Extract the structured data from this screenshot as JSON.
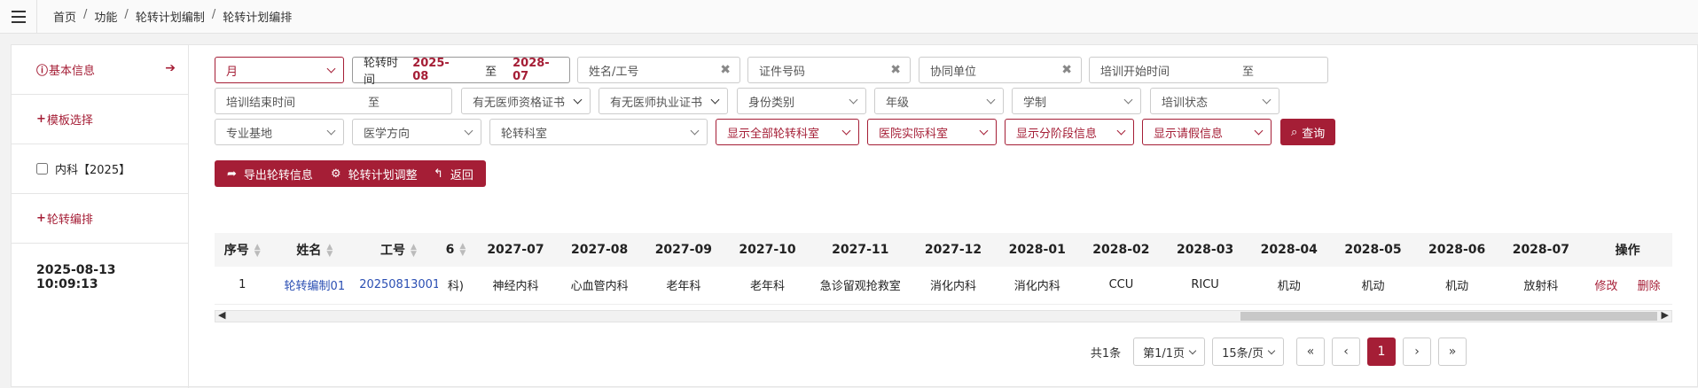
{
  "breadcrumb": [
    "首页",
    "功能",
    "轮转计划编制",
    "轮转计划编排"
  ],
  "sidebar": {
    "basic_info": "基本信息",
    "template_select": "模板选择",
    "checkbox_label": "内科【2025】",
    "rotation_edit": "轮转编排",
    "timestamp": "2025-08-13 10:09:13"
  },
  "filters": {
    "period": "月",
    "rotation_time_label": "轮转时间",
    "rotation_start": "2025-08",
    "rotation_to": "至",
    "rotation_end": "2028-07",
    "name_placeholder": "姓名/工号",
    "cert_placeholder": "证件号码",
    "coop_placeholder": "协同单位",
    "train_start_placeholder": "培训开始时间",
    "train_start_to": "至",
    "train_end_placeholder": "培训结束时间",
    "train_end_to": "至",
    "doctor_qual": "有无医师资格证书",
    "doctor_practice": "有无医师执业证书",
    "identity": "身份类别",
    "grade": "年级",
    "edu_system": "学制",
    "train_status": "培训状态",
    "base": "专业基地",
    "direction": "医学方向",
    "rotation_dept": "轮转科室",
    "show_all_dept": "显示全部轮转科室",
    "hospital_dept": "医院实际科室",
    "show_stage": "显示分阶段信息",
    "show_leave": "显示请假信息",
    "query_button": "查询"
  },
  "actions": {
    "export": "导出轮转信息",
    "adjust": "轮转计划调整",
    "back": "返回"
  },
  "table": {
    "headers": [
      "序号",
      "姓名",
      "工号",
      "6",
      "2027-07",
      "2027-08",
      "2027-09",
      "2027-10",
      "2027-11",
      "2027-12",
      "2028-01",
      "2028-02",
      "2028-03",
      "2028-04",
      "2028-05",
      "2028-06",
      "2028-07",
      "操作"
    ],
    "rows": [
      {
        "no": "1",
        "name": "轮转编制01",
        "id": "20250813001",
        "col6": "科)",
        "months": [
          "神经内科",
          "心血管内科",
          "老年科",
          "老年科",
          "急诊留观抢救室",
          "消化内科",
          "消化内科",
          "CCU",
          "RICU",
          "机动",
          "机动",
          "机动",
          "放射科"
        ],
        "edit": "修改",
        "delete": "删除"
      }
    ]
  },
  "pager": {
    "total": "共1条",
    "page": "第1/1页",
    "per_page": "15条/页",
    "first": "«",
    "prev": "‹",
    "current": "1",
    "next": "›",
    "last": "»"
  },
  "colors": {
    "accent": "#a51e36",
    "link": "#2b4fb3"
  }
}
